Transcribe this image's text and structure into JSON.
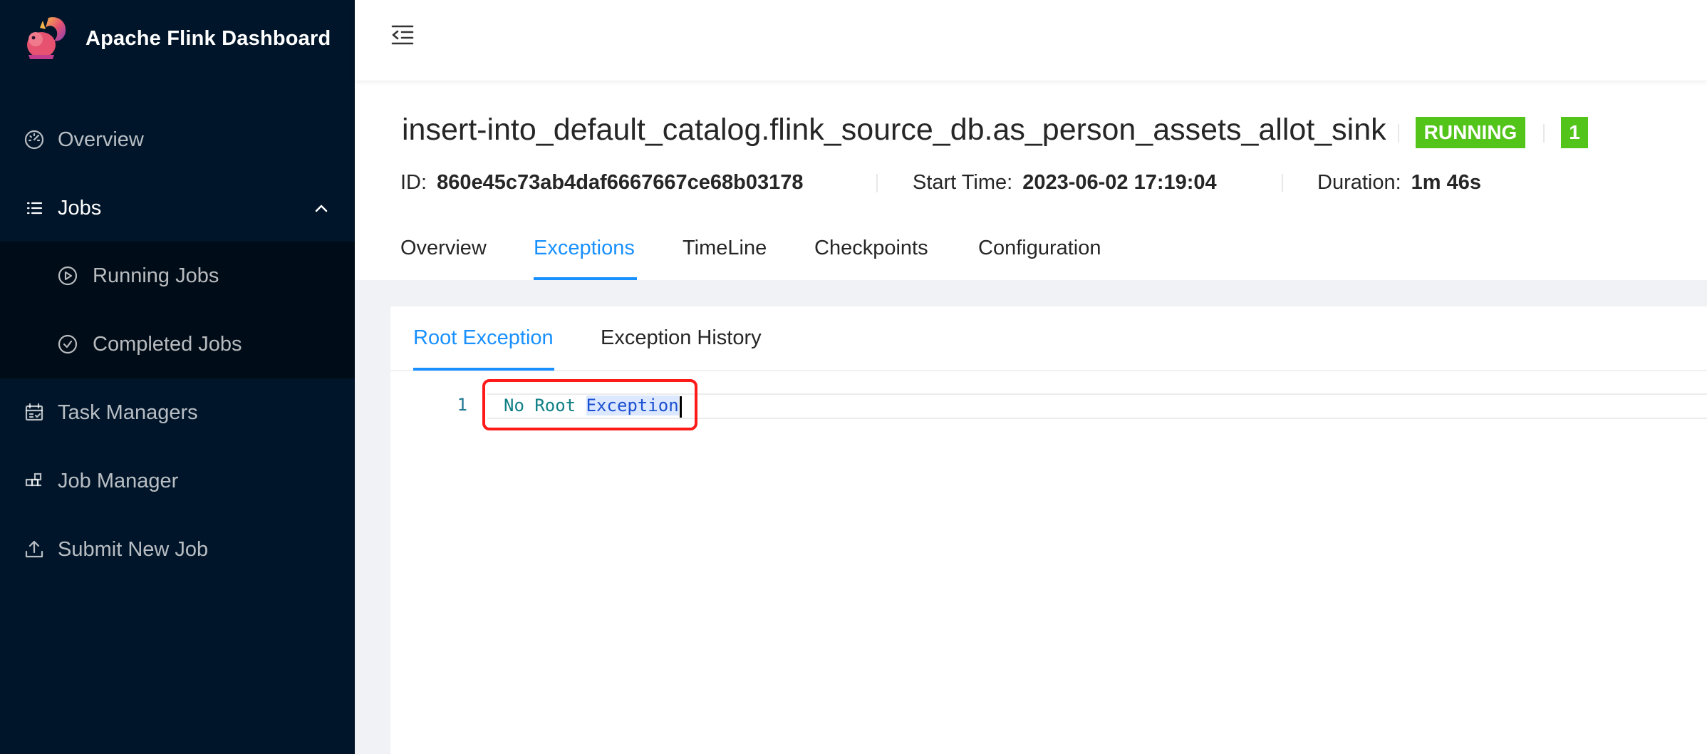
{
  "app": {
    "title": "Apache Flink Dashboard"
  },
  "sidebar": {
    "items": [
      {
        "label": "Overview",
        "icon": "dashboard-icon"
      },
      {
        "label": "Jobs",
        "icon": "list-icon",
        "expanded": true
      },
      {
        "label": "Running Jobs",
        "icon": "play-circle-icon"
      },
      {
        "label": "Completed Jobs",
        "icon": "check-circle-icon"
      },
      {
        "label": "Task Managers",
        "icon": "schedule-icon"
      },
      {
        "label": "Job Manager",
        "icon": "build-icon"
      },
      {
        "label": "Submit New Job",
        "icon": "upload-icon"
      }
    ]
  },
  "header": {
    "menu_toggle_icon": "menu-fold-icon"
  },
  "job": {
    "name": "insert-into_default_catalog.flink_source_db.as_person_assets_allot_sink",
    "status": "RUNNING",
    "count": "1",
    "id_label": "ID:",
    "id_value": "860e45c73ab4daf6667667ce68b03178",
    "start_label": "Start Time:",
    "start_value": "2023-06-02 17:19:04",
    "duration_label": "Duration:",
    "duration_value": "1m 46s"
  },
  "tabs": {
    "primary": [
      "Overview",
      "Exceptions",
      "TimeLine",
      "Checkpoints",
      "Configuration"
    ],
    "active_primary": "Exceptions",
    "secondary": [
      "Root Exception",
      "Exception History"
    ],
    "active_secondary": "Root Exception"
  },
  "editor": {
    "line_number": "1",
    "text_part1": "No Root ",
    "text_part2": "Exception"
  },
  "colors": {
    "sidebar_bg": "#001529",
    "accent": "#1890ff",
    "status_green": "#52c41a",
    "highlight_red": "#ff1a1a"
  }
}
